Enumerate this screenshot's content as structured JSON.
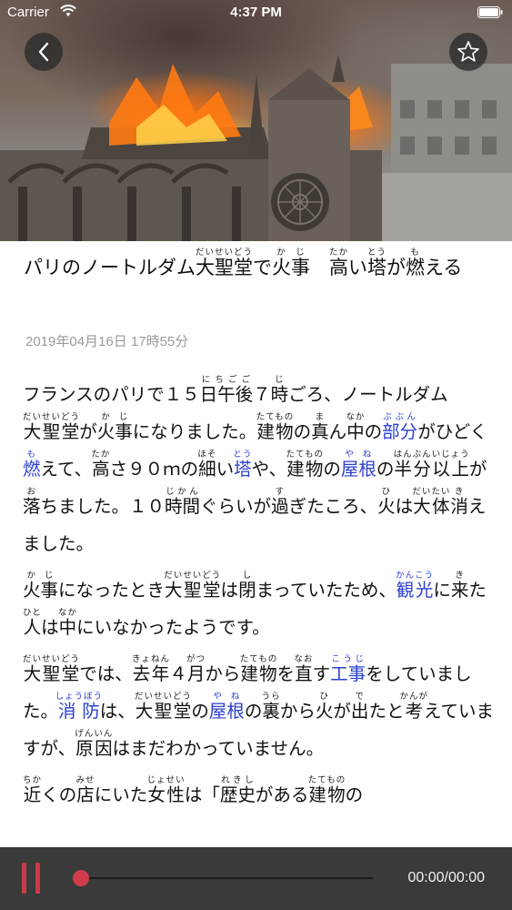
{
  "status_bar": {
    "carrier": "Carrier",
    "time": "4:37 PM"
  },
  "hero": {
    "back_icon": "chevron-left-icon",
    "favorite_icon": "star-outline-icon"
  },
  "article": {
    "title_parts": {
      "t1": "パリのノートルダム",
      "w1": "大聖堂",
      "r1": "だいせいどう",
      "t2": "で",
      "w2": "火事",
      "r2": "かじ",
      "t3": "　",
      "w3": "高",
      "r3": "たか",
      "t4": "い",
      "w4": "塔",
      "r4": "とう",
      "t5": "が",
      "w5": "燃",
      "r5": "も",
      "t6": "える"
    },
    "date": "2019年04月16日 17時55分"
  },
  "body": {
    "p1": {
      "a1": "フランスのパリで１５",
      "k1": "日午後",
      "k1r": "にちごご",
      "a2": "７",
      "k2": "時",
      "k2r": "じ",
      "a3": "ごろ、ノートルダム",
      "k3": "大聖堂",
      "k3r": "だいせいどう",
      "a4": "が",
      "k4": "火事",
      "k4r": "かじ",
      "a5": "になりました。",
      "k5": "建物",
      "k5r": "たてもの",
      "a6": "の",
      "k6": "真",
      "k6r": "ま",
      "a7": "ん",
      "k7": "中",
      "k7r": "なか",
      "a8": "の",
      "k8": "部分",
      "k8r": "ぶぶん",
      "a9": "がひどく",
      "k9": "燃",
      "k9r": "も",
      "a10": "えて、",
      "k10": "高",
      "k10r": "たか",
      "a11": "さ９０ｍの",
      "k11": "細",
      "k11r": "ほそ",
      "a12": "い",
      "k12": "塔",
      "k12r": "とう",
      "a13": "や、",
      "k13": "建物",
      "k13r": "たてもの",
      "a14": "の",
      "k14": "屋根",
      "k14r": "やね",
      "a15": "の",
      "k15": "半分以上",
      "k15r": "はんぶんいじょう",
      "a16": "が",
      "k16": "落",
      "k16r": "お",
      "a17": "ちました。１０",
      "k17": "時間",
      "k17r": "じかん",
      "a18": "ぐらいが",
      "k18": "過",
      "k18r": "す",
      "a19": "ぎたころ、",
      "k19": "火",
      "k19r": "ひ",
      "a20": "は",
      "k20": "大体",
      "k20r": "だいたい",
      "a21": "",
      "k21": "消",
      "k21r": "き",
      "a22": "えました。"
    },
    "p2": {
      "k1": "火事",
      "k1r": "かじ",
      "a1": "になったとき",
      "k2": "大聖堂",
      "k2r": "だいせいどう",
      "a2": "は",
      "k3": "閉",
      "k3r": "し",
      "a3": "まっていたため、",
      "k4": "観光",
      "k4r": "かんこう",
      "a4": "に",
      "k5": "来",
      "k5r": "き",
      "a5": "た",
      "k6": "人",
      "k6r": "ひと",
      "a6": "は",
      "k7": "中",
      "k7r": "なか",
      "a7": "にいなかったようです。"
    },
    "p3": {
      "k1": "大聖堂",
      "k1r": "だいせいどう",
      "a1": "では、",
      "k2": "去年",
      "k2r": "きょねん",
      "a2": "４",
      "k3": "月",
      "k3r": "がつ",
      "a3": "から",
      "k4": "建物",
      "k4r": "たてもの",
      "a4": "を",
      "k5": "直",
      "k5r": "なお",
      "a5": "す",
      "k6": "工事",
      "k6r": "こうじ",
      "a6": "をしていました。",
      "k7": "消防",
      "k7r": "しょうぼう",
      "a7": "は、",
      "k8": "大聖堂",
      "k8r": "だいせいどう",
      "a8": "の",
      "k9": "屋根",
      "k9r": "やね",
      "a9": "の",
      "k10": "裏",
      "k10r": "うら",
      "a10": "から",
      "k11": "火",
      "k11r": "ひ",
      "a11": "が",
      "k12": "出",
      "k12r": "で",
      "a12": "たと",
      "k13": "考",
      "k13r": "かんが",
      "a13": "えていますが、",
      "k14": "原因",
      "k14r": "げんいん",
      "a14": "はまだわかっていません。"
    },
    "p4": {
      "k1": "近",
      "k1r": "ちか",
      "a1": "くの",
      "k2": "店",
      "k2r": "みせ",
      "a2": "にいた",
      "k3": "女性",
      "k3r": "じょせい",
      "a3": "は「",
      "k4": "歴史",
      "k4r": "れきし",
      "a4": "がある",
      "k5": "建物",
      "k5r": "たてもの",
      "a5": "の"
    }
  },
  "player": {
    "time": "00:00/00:00",
    "progress": 0,
    "pause_icon": "pause-icon"
  },
  "colors": {
    "keyword_blue": "#2a3fcf",
    "player_background": "#3a3a3a",
    "player_accent": "#cf3d4b"
  }
}
